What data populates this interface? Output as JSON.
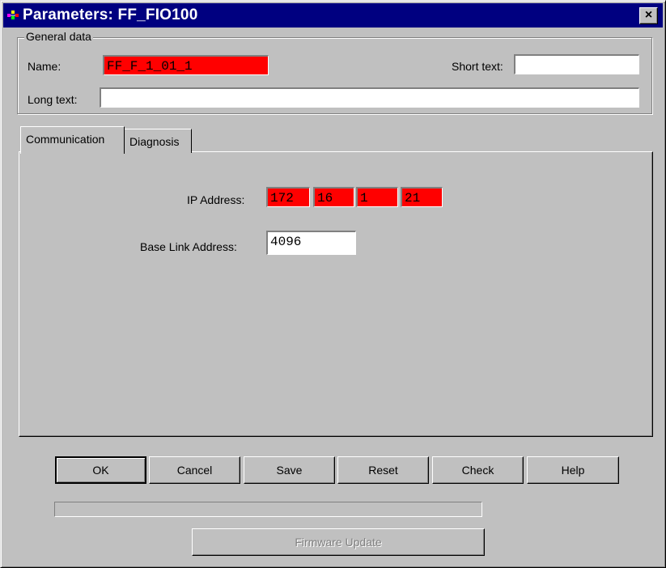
{
  "window": {
    "title": "Parameters: FF_FIO100",
    "close_glyph": "×"
  },
  "icons": {
    "app": "parameters-app-icon",
    "close": "close-icon"
  },
  "general": {
    "group_label": "General data",
    "name_label": "Name:",
    "name_value": "FF_F_1_01_1",
    "short_text_label": "Short text:",
    "short_text_value": "",
    "long_text_label": "Long text:",
    "long_text_value": ""
  },
  "tabs": [
    {
      "label": "Communication",
      "active": true
    },
    {
      "label": "Diagnosis",
      "active": false
    }
  ],
  "communication": {
    "ip_label": "IP Address:",
    "ip_octets": [
      "172",
      "16",
      "1",
      "21"
    ],
    "base_link_label": "Base Link Address:",
    "base_link_value": "4096"
  },
  "buttons": {
    "ok": "OK",
    "cancel": "Cancel",
    "save": "Save",
    "reset": "Reset",
    "check": "Check",
    "help": "Help",
    "firmware_update": "Firmware Update"
  },
  "progress": {
    "value": 0
  },
  "colors": {
    "error_field": "#ff0000",
    "title_bar": "#000080",
    "face": "#c0c0c0"
  }
}
